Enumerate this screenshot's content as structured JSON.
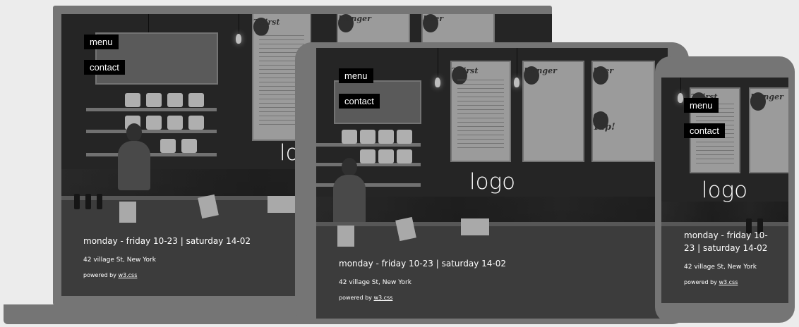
{
  "nav": {
    "menu_label": "menu",
    "contact_label": "contact"
  },
  "hero": {
    "logo_text": "logo",
    "hours": "monday - friday 10-23 | saturday 14-02",
    "hours_phone_line1": "monday - friday 10-",
    "hours_phone_line2": "23 | saturday 14-02",
    "address": "42 village St, New York",
    "powered_prefix": "powered by",
    "powered_link": "w3.css"
  },
  "photo": {
    "boards": [
      "Thirst",
      "Hunger",
      "Beer"
    ],
    "board_tagline": "On Tap!"
  },
  "colors": {
    "page_bg": "#ececec",
    "device_frame": "#757575",
    "nav_button_bg": "#000000",
    "overlay_text": "#ffffff"
  }
}
